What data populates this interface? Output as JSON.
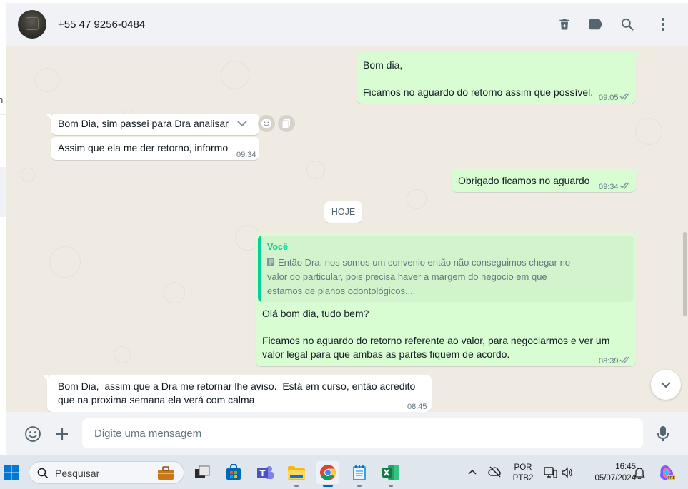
{
  "sidebar_fragment": {
    "cut_text": "n"
  },
  "header": {
    "contact_name": "+55 47 9256-0484",
    "icons": [
      "delete-icon",
      "label-icon",
      "search-icon",
      "menu-icon"
    ]
  },
  "messages": [
    {
      "dir": "out",
      "lines": [
        "Bom dia,",
        "",
        "Ficamos no aguardo do retorno assim que possível."
      ],
      "time": "09:05",
      "status": "read"
    },
    {
      "dir": "in",
      "lines": [
        "Bom Dia, sim passei para Dra analisar"
      ],
      "time": ""
    },
    {
      "dir": "in",
      "lines": [
        "Assim que ela me der retorno, informo"
      ],
      "time": "09:34"
    },
    {
      "dir": "out",
      "lines": [
        "Obrigado ficamos no aguardo"
      ],
      "time": "09:34",
      "status": "read"
    },
    {
      "dir": "out",
      "quote": {
        "author": "Você",
        "lines": [
          "Então Dra. nos somos um convenio então não conseguimos chegar no",
          "valor do particular, pois precisa haver a margem do negocio em que",
          "estamos de planos odontológicos...."
        ]
      },
      "lines": [
        "Olá bom dia, tudo bem?",
        "",
        "Ficamos no aguardo do retorno referente ao valor, para negociarmos e ver um",
        "valor legal para que ambas as partes fiquem de acordo."
      ],
      "time": "08:39",
      "status": "read"
    },
    {
      "dir": "in",
      "lines": [
        "Bom Dia,  assim que a Dra me retornar lhe aviso.  Está em curso, então acredito",
        "que na proxima semana ela verá com calma"
      ],
      "time": "08:45"
    }
  ],
  "day_separator": "HOJE",
  "composer": {
    "placeholder": "Digite uma mensagem"
  },
  "taskbar": {
    "search_label": "Pesquisar",
    "language_top": "POR",
    "language_bottom": "PTB2",
    "time": "16:45",
    "date": "05/07/2024",
    "apps": [
      "start-icon",
      "work-icon",
      "task-view-icon",
      "store-icon",
      "teams-icon",
      "file-explorer-icon",
      "chrome-icon",
      "notepad-icon",
      "excel-icon"
    ]
  },
  "colors": {
    "outgoing": "#d9fdd3",
    "incoming": "#ffffff",
    "chat_bg": "#efeae2",
    "accent": "#06cf9c",
    "read_tick": "#8696a0"
  }
}
